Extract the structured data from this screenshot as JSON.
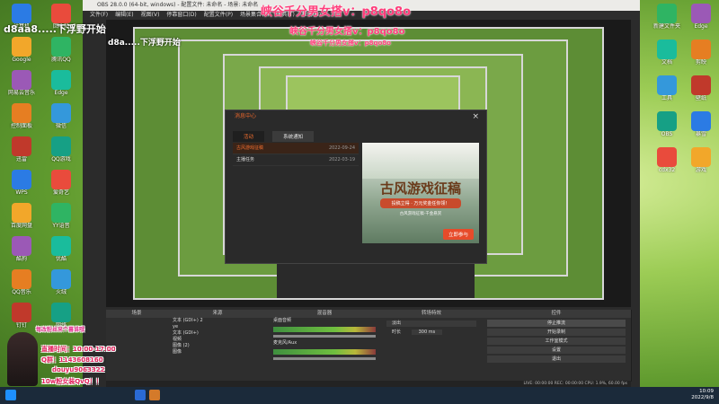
{
  "overlay": {
    "line1": "峡谷千分男女搭v：p8qo8o",
    "line2": "峡谷千分男女搭v：p8qo8o",
    "line3": "峡谷千分男女搭v：p8qo8o",
    "left_caption": "d8aa8.....下浮野开始",
    "left_caption2": "d8a.....下浮野开始"
  },
  "obs": {
    "title": "OBS 28.0.0 (64-bit, windows) - 配置文件: 未命名 - 场景: 未命名",
    "menu": [
      "文件(F)",
      "编辑(E)",
      "视图(V)",
      "停靠窗口(D)",
      "配置文件(P)",
      "场景集合(S)",
      "工具(T)",
      "帮助(H)"
    ],
    "docks": {
      "scenes": "场景",
      "sources": "来源",
      "mixer": "混音器",
      "transitions": "转场特效",
      "controls": "控件"
    },
    "sources": [
      "文本 (GDI+) 2",
      "ye",
      "文本 (GDI+)",
      "视频",
      "图像 (2)",
      "图像"
    ],
    "mixer_channels": [
      "桌面音频",
      "麦克风/Aux"
    ],
    "transition": {
      "type": "淡出",
      "duration_label": "时长",
      "duration": "300 ms"
    },
    "controls": [
      "停止推流",
      "开始录制",
      "工作室模式",
      "设置",
      "退出"
    ],
    "status": "LIVE: 00:00:00   REC: 00:00:00   CPU: 1.9%, 60.00 fps"
  },
  "dialog": {
    "title": "消息中心",
    "close": "×",
    "tabs": [
      "活动",
      "系统通知"
    ],
    "items": [
      {
        "label": "古风游戏征稿",
        "date": "2022-09-24"
      },
      {
        "label": "主播任务",
        "date": "2022-03-19"
      }
    ],
    "ad_title": "古风游戏征稿",
    "ad_subtitle": "古风游戏征稿·千金悬赏",
    "ad_banner": "投稿立得 · 万元奖金任你领！",
    "ad_button": "立即参与"
  },
  "streamer": {
    "line1": "直播时间：10:00-17:00",
    "line2": "Q群：1143608160",
    "line3": "douyu9063322",
    "line4": "10w粉女装QvQ！！",
    "line5": "每改粉丝来个暮谁哦"
  },
  "desktop_icons_left": [
    "计算机",
    "回收站",
    "Google",
    "腾讯QQ",
    "网易云音乐",
    "Edge",
    "控制面板",
    "微信",
    "迅雷",
    "QQ游戏",
    "WPS",
    "爱奇艺",
    "百度网盘",
    "YY语音",
    "酷狗",
    "优酷",
    "QQ音乐",
    "火绒",
    "钉钉",
    "网络"
  ],
  "desktop_icons_right": [
    "新建文件夹",
    "Edge",
    "文档",
    "剪映",
    "工具",
    "壁纸",
    "OBS",
    "暴雪",
    "cdx32",
    "游戏"
  ],
  "taskbar": {
    "time": "10:09",
    "date": "2022/9/8"
  },
  "colors": {
    "accent": "#f36e2f",
    "overlay_pink": "#ff3c7a",
    "obs_bg": "#2b2b2b"
  }
}
